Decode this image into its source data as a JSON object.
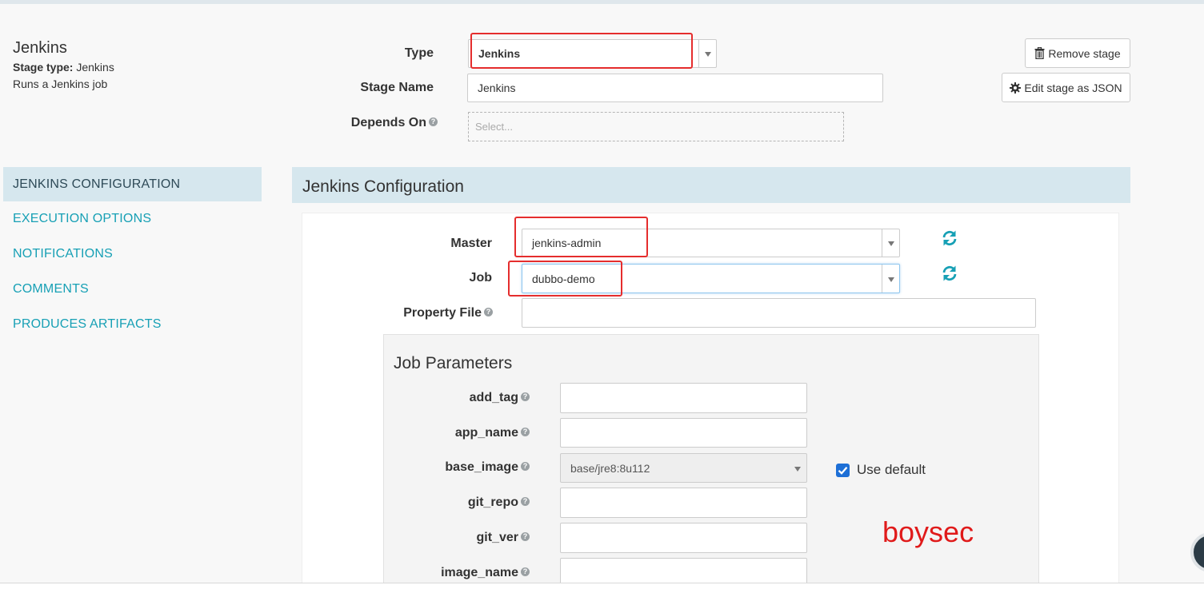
{
  "stage": {
    "title": "Jenkins",
    "type_label": "Stage type:",
    "type_value": "Jenkins",
    "description": "Runs a Jenkins job"
  },
  "form": {
    "type_label": "Type",
    "type_value": "Jenkins",
    "stage_name_label": "Stage Name",
    "stage_name_value": "Jenkins",
    "depends_on_label": "Depends On",
    "depends_on_placeholder": "Select..."
  },
  "buttons": {
    "remove_stage": "Remove stage",
    "edit_json": "Edit stage as JSON"
  },
  "nav": {
    "items": [
      {
        "label": "JENKINS CONFIGURATION",
        "active": true
      },
      {
        "label": "EXECUTION OPTIONS",
        "active": false
      },
      {
        "label": "NOTIFICATIONS",
        "active": false
      },
      {
        "label": "COMMENTS",
        "active": false
      },
      {
        "label": "PRODUCES ARTIFACTS",
        "active": false
      }
    ]
  },
  "config": {
    "title": "Jenkins Configuration",
    "master_label": "Master",
    "master_value": "jenkins-admin",
    "job_label": "Job",
    "job_value": "dubbo-demo",
    "property_file_label": "Property File",
    "property_file_value": ""
  },
  "job_parameters": {
    "title": "Job Parameters",
    "params": [
      {
        "name": "add_tag",
        "value": ""
      },
      {
        "name": "app_name",
        "value": ""
      },
      {
        "name": "base_image",
        "value": "base/jre8:8u112"
      },
      {
        "name": "git_repo",
        "value": ""
      },
      {
        "name": "git_ver",
        "value": ""
      },
      {
        "name": "image_name",
        "value": ""
      }
    ],
    "use_default_label": "Use default",
    "use_default_checked": true
  },
  "watermark": "boysec",
  "colors": {
    "accent": "#17a0b5",
    "section_bg": "#d6e7ee",
    "highlight_red": "#e52d2d",
    "checkbox_blue": "#1d6fd6"
  }
}
